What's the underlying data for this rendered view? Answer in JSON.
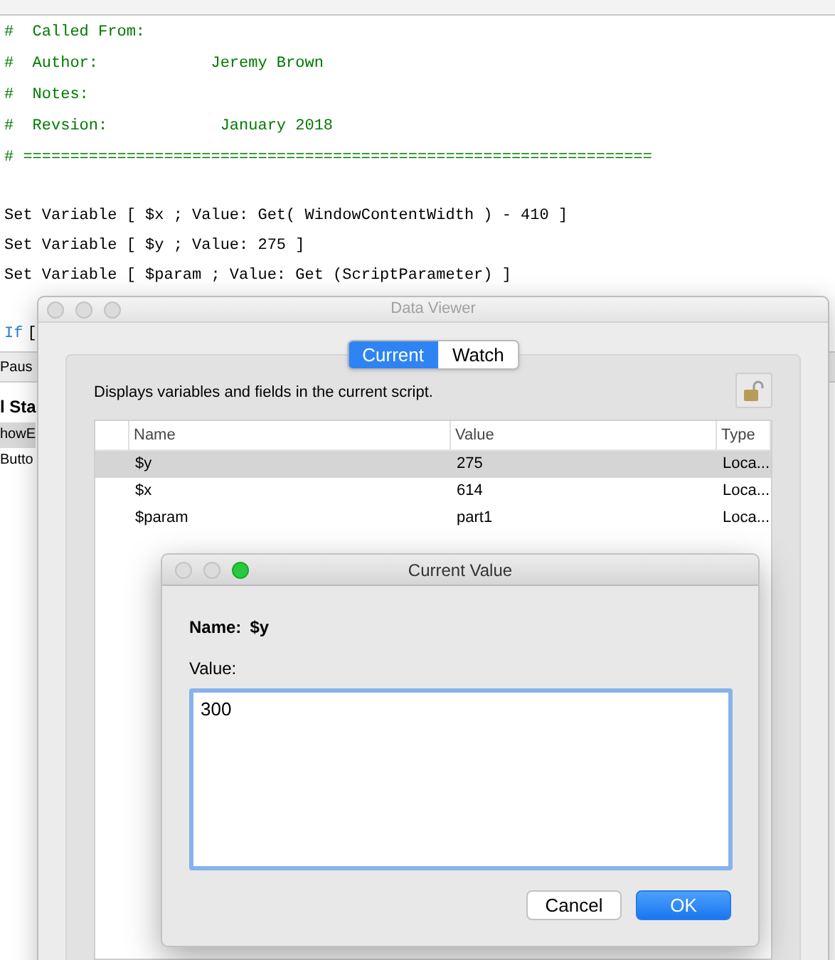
{
  "editor": {
    "lines": [
      {
        "kind": "comment",
        "text": "#  Called From:"
      },
      {
        "kind": "comment",
        "text": "#  Author:            Jeremy Brown"
      },
      {
        "kind": "comment",
        "text": "#  Notes:"
      },
      {
        "kind": "comment",
        "text": "#  Revsion:            January 2018"
      },
      {
        "kind": "comment",
        "text": "# ==================================================================="
      },
      {
        "kind": "gap"
      },
      {
        "kind": "step",
        "text": "Set Variable [ $x ; Value: Get( WindowContentWidth ) - 410 ]"
      },
      {
        "kind": "step",
        "text": "Set Variable [ $y ; Value: 275 ]"
      },
      {
        "kind": "step",
        "text": "Set Variable [ $param ; Value: Get (ScriptParameter) ]"
      },
      {
        "kind": "gap"
      },
      {
        "kind": "control",
        "keyword": "If",
        "text": "["
      }
    ]
  },
  "side_panel": {
    "toolbar_label": "Paus",
    "heading": "l Sta",
    "items": [
      {
        "text": "howE",
        "selected": true
      },
      {
        "text": "Butto",
        "selected": false
      }
    ]
  },
  "data_viewer": {
    "title": "Data Viewer",
    "tabs": [
      {
        "label": "Current",
        "selected": true
      },
      {
        "label": "Watch",
        "selected": false
      }
    ],
    "description": "Displays variables and fields in the current script.",
    "columns": [
      "Name",
      "Value",
      "Type"
    ],
    "rows": [
      {
        "name": "$y",
        "value": "275",
        "type": "Loca...",
        "selected": true
      },
      {
        "name": "$x",
        "value": "614",
        "type": "Loca...",
        "selected": false
      },
      {
        "name": "$param",
        "value": "part1",
        "type": "Loca...",
        "selected": false
      }
    ]
  },
  "dialog": {
    "title": "Current Value",
    "name_label": "Name:",
    "name_value": "$y",
    "value_label": "Value:",
    "value": "300",
    "buttons": [
      {
        "label": "Cancel",
        "kind": "secondary"
      },
      {
        "label": "OK",
        "kind": "primary"
      }
    ]
  }
}
